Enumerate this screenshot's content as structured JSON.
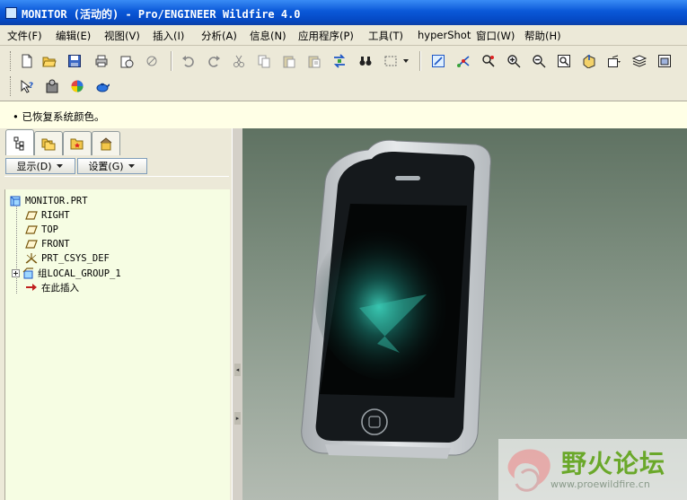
{
  "window": {
    "title": "MONITOR (活动的) - Pro/ENGINEER Wildfire 4.0"
  },
  "menu": [
    {
      "label": "文件(F)"
    },
    {
      "label": "编辑(E)"
    },
    {
      "label": "视图(V)"
    },
    {
      "label": "插入(I)"
    },
    {
      "label": "分析(A)"
    },
    {
      "label": "信息(N)"
    },
    {
      "label": "应用程序(P)"
    },
    {
      "label": "工具(T)"
    },
    {
      "label": "hyperShot"
    },
    {
      "label": "窗口(W)"
    },
    {
      "label": "帮助(H)"
    }
  ],
  "message": {
    "text": "• 已恢复系统颜色。"
  },
  "navigator": {
    "show_button": "显示(D)",
    "settings_button": "设置(G)",
    "tree": [
      {
        "label": "MONITOR.PRT"
      },
      {
        "label": "RIGHT"
      },
      {
        "label": "TOP"
      },
      {
        "label": "FRONT"
      },
      {
        "label": "PRT_CSYS_DEF"
      },
      {
        "label": "组LOCAL_GROUP_1"
      },
      {
        "label": "在此插入"
      }
    ]
  },
  "watermark": {
    "text": "野火论坛",
    "url": "www.proewildfire.cn"
  },
  "colors": {
    "title_bar": "#0a58d8",
    "tree_bg": "#f6fde3",
    "message_bg": "#ffffe6"
  }
}
